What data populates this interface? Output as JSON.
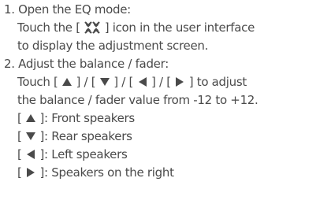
{
  "colors": {
    "text": "#4a4a4a",
    "background": "#ffffff"
  },
  "icons": {
    "eq": "eq-adjustment-icon",
    "up": "triangle-up-icon",
    "down": "triangle-down-icon",
    "left": "triangle-left-icon",
    "right": "triangle-right-icon"
  },
  "step1": {
    "heading": "1. Open the EQ mode:",
    "touch_prefix": "Touch the [",
    "touch_suffix": "] icon in the user interface",
    "continuation": "to display the adjustment screen."
  },
  "step2": {
    "heading": "2. Adjust the balance / fader:",
    "touch_prefix": "Touch [",
    "sep1": "] / [",
    "sep2": "] / [",
    "sep3": "] / [",
    "touch_suffix": "] to adjust",
    "continuation": "the balance / fader value from -12 to +12.",
    "legend": [
      {
        "open": "[",
        "close": "]: Front speakers"
      },
      {
        "open": "[",
        "close": "]: Rear speakers"
      },
      {
        "open": "[",
        "close": "]: Left speakers"
      },
      {
        "open": "[",
        "close": "]: Speakers on the right"
      }
    ]
  }
}
